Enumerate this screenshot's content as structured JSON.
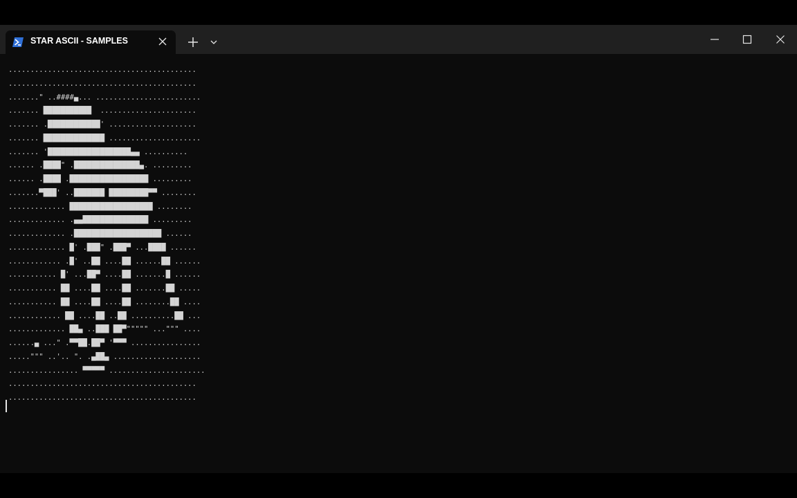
{
  "tab": {
    "title": "STAR ASCII - SAMPLES",
    "icon": "powershell-icon"
  },
  "toolbar": {
    "new_tab_icon": "plus-icon",
    "dropdown_icon": "chevron-down-icon"
  },
  "window_controls": {
    "minimize_icon": "minimize-icon",
    "maximize_icon": "maximize-icon",
    "close_icon": "close-icon"
  },
  "terminal": {
    "ascii_art": "...........................................\n...........................................\n.......\" ..####▄... ........................\n....... ███████████  ......................\n....... .████████████' ....................\n....... ██████████████ .....................\n....... '███████████████████▄▄ ..........\n...... .████\" .███████████████▄. .........\n...... .████ .██████████████████ .........\n.......▀███' ..███████ █████████▀▀ ........\n............. ███████████████████ ........\n............. .▄▄███████████████ .........\n............. .████████████████████ ......\n............. █' .███\" .███▀ ...████ ......\n............ .█' ..██ ....██ ......██ ......\n........... █' ...██▀ ....██ .......█ ......\n........... ██ ....██ ....██ .......██ .....\n........... ██ ....██ ....██ ........██ ....\n............ ██ ....██ ..██ ..........██ ...\n............. ██▄ ..███ ██▀\"\"\"\"\" ...\"\"\" ....\n......▄ ...\" .▀▀██.██▀ '▀▀▀ ................\n.....\"\"\" ..'.. \". .▄██▄ ....................\n................ ▀▀▀▀▀ ......................\n...........................................\n..........................................."
  }
}
